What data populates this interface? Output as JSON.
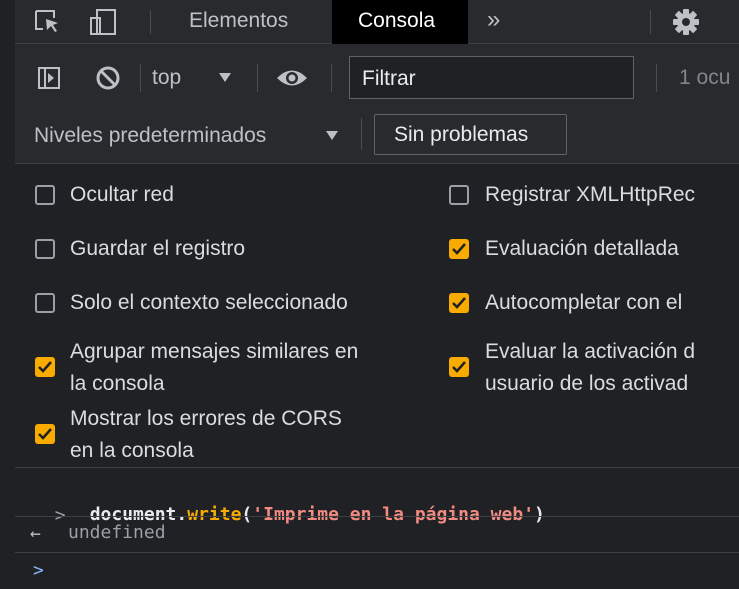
{
  "tabs": {
    "elements_label": "Elementos",
    "console_label": "Consola",
    "more_label": "»"
  },
  "toolbar": {
    "context_label": "top",
    "filter_value": "Filtrar",
    "issues_count": "1 ocu"
  },
  "levels": {
    "label": "Niveles predeterminados",
    "issues_button": "Sin problemas"
  },
  "settings": {
    "left": [
      {
        "label": "Ocultar red",
        "checked": false
      },
      {
        "label": "Guardar el registro",
        "checked": false
      },
      {
        "label": "Solo el contexto seleccionado",
        "checked": false
      },
      {
        "label_1": "Agrupar mensajes similares en",
        "label_2": "la consola",
        "checked": true
      },
      {
        "label_1": "Mostrar los errores de CORS",
        "label_2": "en la consola",
        "checked": true
      }
    ],
    "right": [
      {
        "label": "Registrar XMLHttpRec",
        "checked": false
      },
      {
        "label": "Evaluación detallada",
        "checked": true
      },
      {
        "label": "Autocompletar con el",
        "checked": true
      },
      {
        "label_1": "Evaluar la activación d",
        "label_2": "usuario de los activad",
        "checked": true
      }
    ]
  },
  "console": {
    "input_prompt": ">",
    "code_object": "document.",
    "code_method": "write",
    "code_open": "(",
    "code_string": "'Imprime en la página web'",
    "code_close": ")",
    "result_prompt": "←",
    "result_value": "undefined",
    "new_prompt": ">"
  },
  "colors": {
    "background": "#202124",
    "toolbar": "#292a2d",
    "checkbox_accent": "#f9ab00",
    "method_color": "#f9ab00",
    "string_color": "#f28b82",
    "prompt_color": "#8ab4f8"
  }
}
